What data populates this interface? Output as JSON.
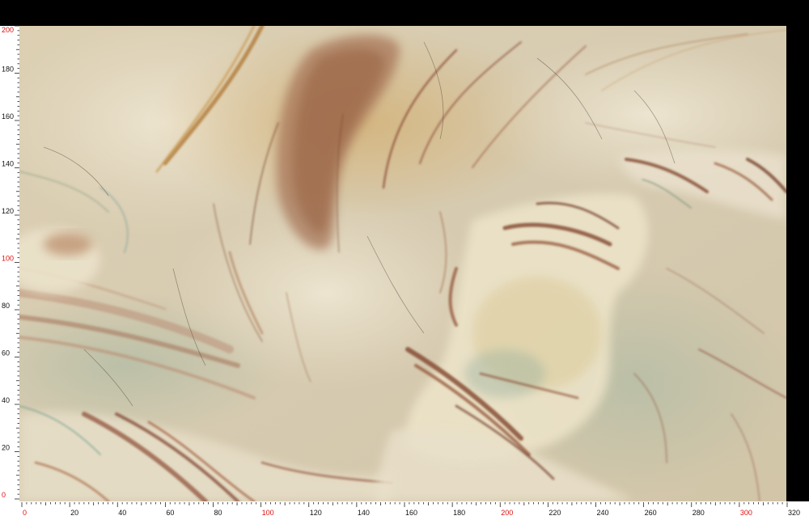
{
  "image": {
    "subject": "polished-stone-slab",
    "colors": {
      "base": "#d8cbb0",
      "cream": "#e6dcc4",
      "ochre": "#c9a064",
      "rust": "#9c5a3c",
      "brown": "#7a4030",
      "sage": "#a9b59c",
      "white": "#efe9d8"
    }
  },
  "ruler": {
    "x_max": 320,
    "y_max": 200,
    "x_labels": [
      {
        "value": 0,
        "text": "0",
        "highlight": true
      },
      {
        "value": 20,
        "text": "20",
        "highlight": false
      },
      {
        "value": 40,
        "text": "40",
        "highlight": false
      },
      {
        "value": 60,
        "text": "60",
        "highlight": false
      },
      {
        "value": 80,
        "text": "80",
        "highlight": false
      },
      {
        "value": 100,
        "text": "100",
        "highlight": true
      },
      {
        "value": 120,
        "text": "120",
        "highlight": false
      },
      {
        "value": 140,
        "text": "140",
        "highlight": false
      },
      {
        "value": 160,
        "text": "160",
        "highlight": false
      },
      {
        "value": 180,
        "text": "180",
        "highlight": false
      },
      {
        "value": 200,
        "text": "200",
        "highlight": true
      },
      {
        "value": 220,
        "text": "220",
        "highlight": false
      },
      {
        "value": 240,
        "text": "240",
        "highlight": false
      },
      {
        "value": 260,
        "text": "260",
        "highlight": false
      },
      {
        "value": 280,
        "text": "280",
        "highlight": false
      },
      {
        "value": 300,
        "text": "300",
        "highlight": true
      },
      {
        "value": 320,
        "text": "320",
        "highlight": false
      }
    ],
    "y_labels": [
      {
        "value": 0,
        "text": "0",
        "highlight": true
      },
      {
        "value": 20,
        "text": "20",
        "highlight": false
      },
      {
        "value": 40,
        "text": "40",
        "highlight": false
      },
      {
        "value": 60,
        "text": "60",
        "highlight": false
      },
      {
        "value": 80,
        "text": "80",
        "highlight": false
      },
      {
        "value": 100,
        "text": "100",
        "highlight": true
      },
      {
        "value": 120,
        "text": "120",
        "highlight": false
      },
      {
        "value": 140,
        "text": "140",
        "highlight": false
      },
      {
        "value": 160,
        "text": "160",
        "highlight": false
      },
      {
        "value": 180,
        "text": "180",
        "highlight": false
      },
      {
        "value": 200,
        "text": "200",
        "highlight": true
      }
    ],
    "label_color": "#111111",
    "highlight_color": "#e01010"
  }
}
